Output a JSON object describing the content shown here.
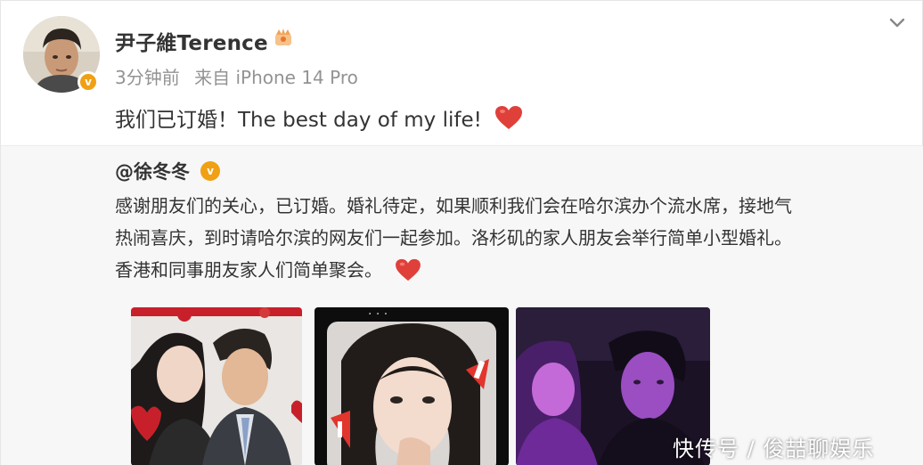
{
  "post": {
    "author_name": "尹子維Terence",
    "timestamp": "3分钟前",
    "source": "来自 iPhone 14 Pro",
    "text": "我们已订婚！The best day of my life!",
    "avatar_icon": "avatar-photo",
    "verified_color": "#f0a014"
  },
  "repost": {
    "author": "@徐冬冬",
    "line1": "感谢朋友们的关心，已订婚。婚礼待定，如果顺利我们会在哈尔滨办个流水席，接地气",
    "line2": "热闹喜庆，到时请哈尔滨的网友们一起参加。洛杉矶的家人朋友会举行简单小型婚礼。",
    "line3": "香港和同事朋友家人们简单聚会。"
  },
  "watermark": "快传号 / 俊喆聊娱乐",
  "colors": {
    "heart": "#e0403a",
    "accent": "#f0a014",
    "meta_text": "#939393"
  }
}
